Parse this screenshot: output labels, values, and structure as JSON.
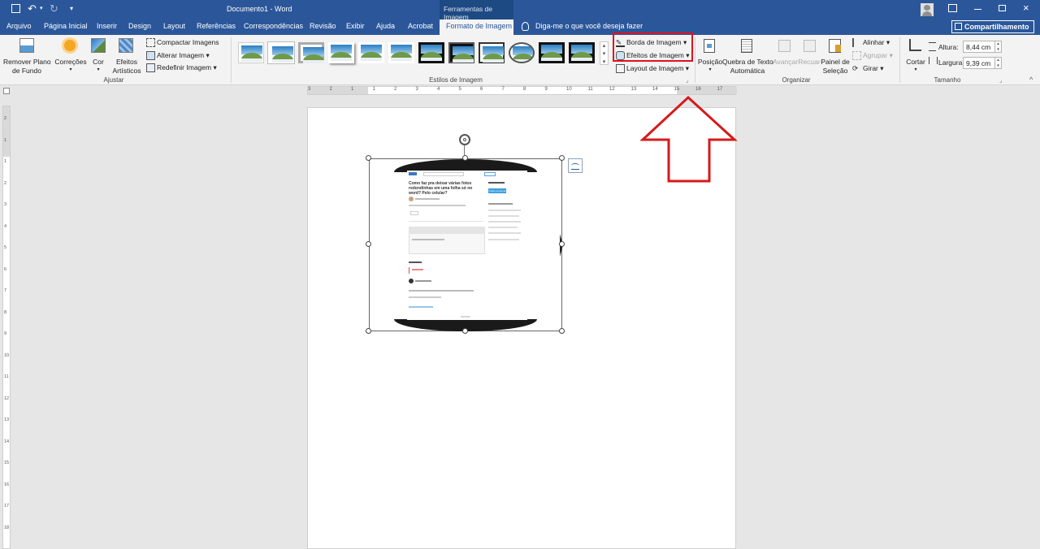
{
  "titlebar": {
    "doc_title": "Documento1 - Word",
    "context_title": "Ferramentas de Imagem",
    "user_icon": "user-icon",
    "min_icon": "minimize-icon",
    "max_icon": "maximize-icon",
    "close_icon": "close-icon"
  },
  "tabs": [
    "Arquivo",
    "Página Inicial",
    "Inserir",
    "Design",
    "Layout",
    "Referências",
    "Correspondências",
    "Revisão",
    "Exibir",
    "Ajuda",
    "Acrobat",
    "Formato de Imagem"
  ],
  "tell_me": "Diga-me o que você deseja fazer",
  "share": "Compartilhamento",
  "ribbon": {
    "remove_bg": [
      "Remover Plano",
      "de Fundo"
    ],
    "corrections": "Correções",
    "color": "Cor",
    "artistic": [
      "Efeitos",
      "Artísticos"
    ],
    "compress": "Compactar Imagens",
    "change": "Alterar Imagem",
    "reset": "Redefinir Imagem",
    "group_adjust": "Ajustar",
    "group_styles": "Estilos de Imagem",
    "border": "Borda de Imagem",
    "effects": "Efeitos de Imagem",
    "layout": "Layout de Imagem",
    "position": "Posição",
    "wrap": [
      "Quebra de Texto",
      "Automática"
    ],
    "forward": "Avançar",
    "backward": "Recuar",
    "selection_pane": [
      "Painel de",
      "Seleção"
    ],
    "align": "Alinhar",
    "group": "Agrupar",
    "rotate": "Girar",
    "group_arrange": "Organizar",
    "crop": "Cortar",
    "height_label": "Altura:",
    "height_value": "8,44 cm",
    "width_label": "Largura:",
    "width_value": "9,39 cm",
    "group_size": "Tamanho"
  },
  "ruler": {
    "top_ticks": [
      "3",
      "2",
      "1",
      "1",
      "2",
      "3",
      "4",
      "5",
      "6",
      "7",
      "8",
      "9",
      "10",
      "11",
      "12",
      "13",
      "14",
      "15",
      "16",
      "17"
    ],
    "left_ticks": [
      "2",
      "1",
      "1",
      "2",
      "3",
      "4",
      "5",
      "6",
      "7",
      "8",
      "9",
      "10",
      "11",
      "12",
      "13",
      "14",
      "15",
      "16",
      "17",
      "18"
    ]
  },
  "image": {
    "question_title": "Como faz pra deixar várias fotos redondinhas em uma folha só no word? Pelo celular?",
    "sidebar_button": "Fazer pergunta",
    "footer_line": "Assinar"
  },
  "annotation": {
    "highlight_color": "#e0121e",
    "arrow_color": "#d61a1a"
  }
}
